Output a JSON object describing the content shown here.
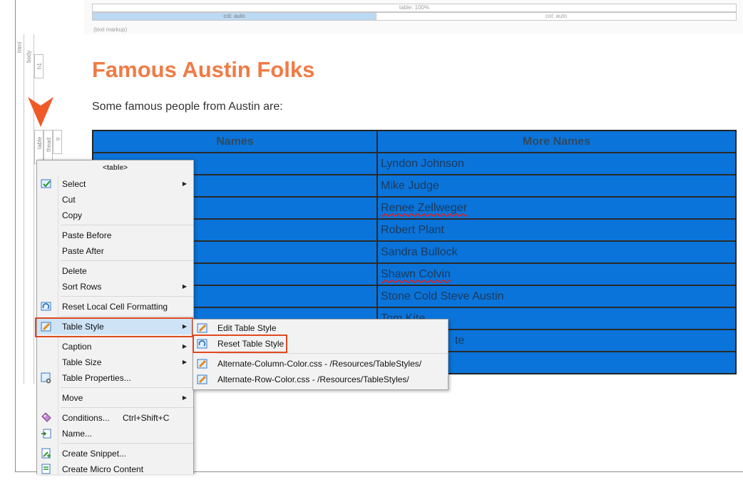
{
  "markup_bar": {
    "table_label": "table: 100%",
    "col1_label": "col: auto",
    "col2_label": "col: auto",
    "text_markup_label": "(text markup)"
  },
  "structure_bars": {
    "html": "html",
    "body": "body",
    "h1": "h1",
    "table": "table",
    "thead": "thead",
    "tr": "tr"
  },
  "document": {
    "title": "Famous Austin Folks",
    "intro": "Some famous people from Austin are:",
    "table": {
      "headers": [
        "Names",
        "More Names"
      ],
      "rows": [
        [
          "",
          "Lyndon Johnson"
        ],
        [
          "",
          "Mike Judge"
        ],
        [
          "",
          "Renee Zellweger"
        ],
        [
          "",
          "Robert Plant"
        ],
        [
          "",
          "Sandra Bullock"
        ],
        [
          "",
          "Shawn Colvin"
        ],
        [
          "",
          "Stone Cold Steve Austin"
        ],
        [
          "",
          "Tom Kite"
        ],
        [
          "",
          "te"
        ],
        [
          "",
          ""
        ]
      ]
    }
  },
  "context_menu": {
    "header": "<table>",
    "items": [
      {
        "label": "Select",
        "submenu": true
      },
      {
        "label": "Cut"
      },
      {
        "label": "Copy"
      },
      {
        "label": "Paste Before"
      },
      {
        "label": "Paste After"
      },
      {
        "label": "Delete"
      },
      {
        "label": "Sort Rows",
        "submenu": true
      },
      {
        "label": "Reset Local Cell Formatting"
      },
      {
        "label": "Table Style",
        "submenu": true
      },
      {
        "label": "Caption",
        "submenu": true
      },
      {
        "label": "Table Size",
        "submenu": true
      },
      {
        "label": "Table Properties..."
      },
      {
        "label": "Move",
        "submenu": true
      },
      {
        "label": "Conditions...",
        "shortcut": "Ctrl+Shift+C"
      },
      {
        "label": "Name..."
      },
      {
        "label": "Create Snippet..."
      },
      {
        "label": "Create Micro Content"
      }
    ]
  },
  "submenu": {
    "items": [
      {
        "label": "Edit Table Style"
      },
      {
        "label": "Reset Table Style"
      },
      {
        "label": "Alternate-Column-Color.css - /Resources/TableStyles/"
      },
      {
        "label": "Alternate-Row-Color.css - /Resources/TableStyles/"
      }
    ]
  },
  "colors": {
    "title": "#f07b45",
    "table_cell": "#0a74da",
    "highlight_border": "#e0491f",
    "menu_hover": "#cfe3f6",
    "pointer_arrow": "#f05a28"
  }
}
